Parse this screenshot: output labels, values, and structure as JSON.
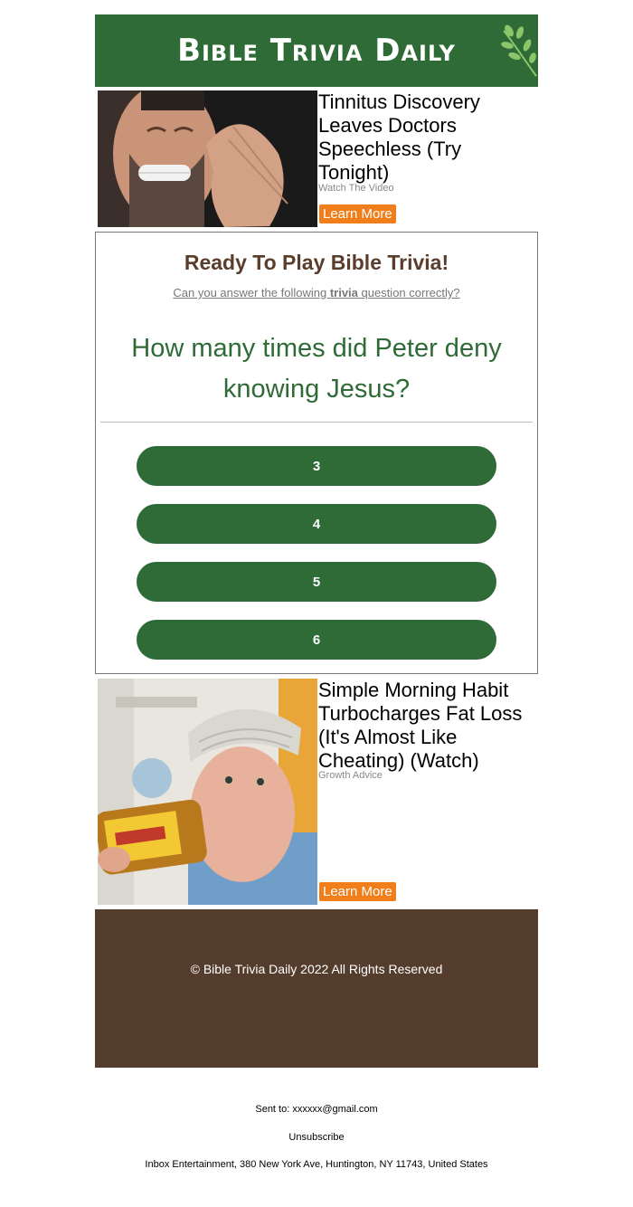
{
  "header": {
    "brand": "Bible Trivia Daily"
  },
  "ad1": {
    "title": "Tinnitus Discovery Leaves Doctors Speechless (Try Tonight)",
    "source": "Watch The Video",
    "button": "Learn More"
  },
  "quiz": {
    "heading": "Ready To Play Bible Trivia!",
    "sub_before": "Can you answer the following ",
    "sub_bold": "trivia",
    "sub_after": " question correctly?",
    "question": "How many times did Peter deny knowing Jesus?",
    "answers": [
      "3",
      "4",
      "5",
      "6"
    ]
  },
  "ad2": {
    "title": "Simple Morning Habit Turbocharges Fat Loss (It's Almost Like Cheating) (Watch)",
    "source": "Growth Advice",
    "button": "Learn More"
  },
  "footer": {
    "copyright": "© Bible Trivia Daily 2022 All Rights Reserved",
    "sent_to": "Sent to: xxxxxx@gmail.com",
    "unsubscribe": "Unsubscribe",
    "address": "Inbox Entertainment, 380 New York Ave, Huntington, NY 11743, United States"
  },
  "colors": {
    "brand_green": "#2e6b36",
    "brown": "#553d2d",
    "orange": "#f07e1b"
  }
}
